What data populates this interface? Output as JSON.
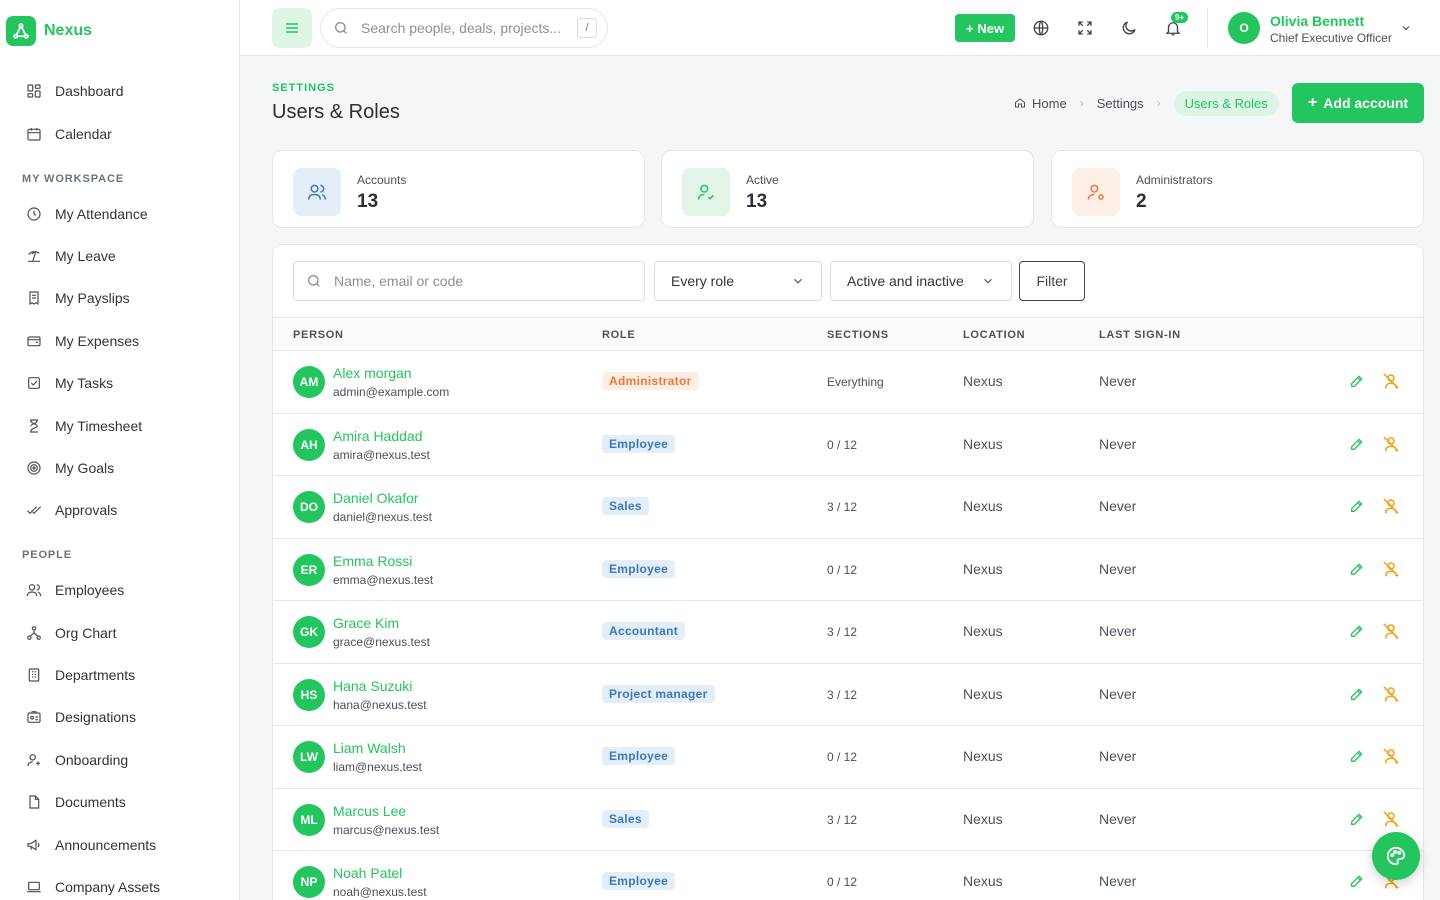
{
  "app": {
    "name": "Nexus",
    "accent": "#22c55e"
  },
  "sidebar": {
    "top_items": [
      {
        "label": "Dashboard",
        "icon": "dashboard-icon"
      },
      {
        "label": "Calendar",
        "icon": "calendar-icon"
      }
    ],
    "sections": [
      {
        "title": "MY WORKSPACE",
        "items": [
          {
            "label": "My Attendance",
            "icon": "clock-icon"
          },
          {
            "label": "My Leave",
            "icon": "beach-icon"
          },
          {
            "label": "My Payslips",
            "icon": "receipt-icon"
          },
          {
            "label": "My Expenses",
            "icon": "wallet-icon"
          },
          {
            "label": "My Tasks",
            "icon": "checkbox-icon"
          },
          {
            "label": "My Timesheet",
            "icon": "hourglass-icon"
          },
          {
            "label": "My Goals",
            "icon": "target-icon"
          },
          {
            "label": "Approvals",
            "icon": "double-check-icon"
          }
        ]
      },
      {
        "title": "PEOPLE",
        "items": [
          {
            "label": "Employees",
            "icon": "users-icon"
          },
          {
            "label": "Org Chart",
            "icon": "hierarchy-icon"
          },
          {
            "label": "Departments",
            "icon": "building-icon"
          },
          {
            "label": "Designations",
            "icon": "id-badge-icon"
          },
          {
            "label": "Onboarding",
            "icon": "user-plus-icon"
          },
          {
            "label": "Documents",
            "icon": "document-icon"
          },
          {
            "label": "Announcements",
            "icon": "megaphone-icon"
          },
          {
            "label": "Company Assets",
            "icon": "laptop-icon"
          }
        ]
      }
    ]
  },
  "topbar": {
    "search_placeholder": "Search people, deals, projects...",
    "search_shortcut": "/",
    "new_label": "New",
    "notification_count": "9+",
    "user": {
      "initial": "O",
      "name": "Olivia Bennett",
      "role": "Chief Executive Officer"
    }
  },
  "header": {
    "eyebrow": "SETTINGS",
    "title": "Users & Roles",
    "breadcrumbs": [
      "Home",
      "Settings",
      "Users & Roles"
    ],
    "add_button": "Add account"
  },
  "stats": [
    {
      "label": "Accounts",
      "value": "13",
      "icon": "users-icon",
      "bg": "#e4eef9",
      "fg": "#3b78c4"
    },
    {
      "label": "Active",
      "value": "13",
      "icon": "user-check-icon",
      "bg": "#e3f5e9",
      "fg": "#22c55e"
    },
    {
      "label": "Administrators",
      "value": "2",
      "icon": "user-cog-icon",
      "bg": "#fdeee6",
      "fg": "#f0783a"
    }
  ],
  "filters": {
    "search_placeholder": "Name, email or code",
    "role_select": "Every role",
    "status_select": "Active and inactive",
    "filter_button": "Filter"
  },
  "table": {
    "columns": [
      "PERSON",
      "ROLE",
      "SECTIONS",
      "LOCATION",
      "LAST SIGN-IN"
    ],
    "rows": [
      {
        "initials": "AM",
        "name": "Alex morgan",
        "email": "admin@example.com",
        "role": "Administrator",
        "sections": "Everything",
        "location": "Nexus",
        "last_sign_in": "Never"
      },
      {
        "initials": "AH",
        "name": "Amira Haddad",
        "email": "amira@nexus.test",
        "role": "Employee",
        "sections": "0 / 12",
        "location": "Nexus",
        "last_sign_in": "Never"
      },
      {
        "initials": "DO",
        "name": "Daniel Okafor",
        "email": "daniel@nexus.test",
        "role": "Sales",
        "sections": "3 / 12",
        "location": "Nexus",
        "last_sign_in": "Never"
      },
      {
        "initials": "ER",
        "name": "Emma Rossi",
        "email": "emma@nexus.test",
        "role": "Employee",
        "sections": "0 / 12",
        "location": "Nexus",
        "last_sign_in": "Never"
      },
      {
        "initials": "GK",
        "name": "Grace Kim",
        "email": "grace@nexus.test",
        "role": "Accountant",
        "sections": "3 / 12",
        "location": "Nexus",
        "last_sign_in": "Never"
      },
      {
        "initials": "HS",
        "name": "Hana Suzuki",
        "email": "hana@nexus.test",
        "role": "Project manager",
        "sections": "3 / 12",
        "location": "Nexus",
        "last_sign_in": "Never"
      },
      {
        "initials": "LW",
        "name": "Liam Walsh",
        "email": "liam@nexus.test",
        "role": "Employee",
        "sections": "0 / 12",
        "location": "Nexus",
        "last_sign_in": "Never"
      },
      {
        "initials": "ML",
        "name": "Marcus Lee",
        "email": "marcus@nexus.test",
        "role": "Sales",
        "sections": "3 / 12",
        "location": "Nexus",
        "last_sign_in": "Never"
      },
      {
        "initials": "NP",
        "name": "Noah Patel",
        "email": "noah@nexus.test",
        "role": "Employee",
        "sections": "0 / 12",
        "location": "Nexus",
        "last_sign_in": "Never"
      }
    ]
  }
}
